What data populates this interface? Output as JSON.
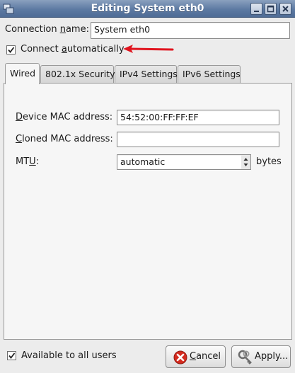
{
  "window": {
    "title": "Editing System eth0"
  },
  "connection": {
    "name_label_pre": "Connection ",
    "name_label_u": "n",
    "name_label_post": "ame:",
    "name_value": "System eth0"
  },
  "connect_automatically": {
    "label_pre": "Connect ",
    "label_u": "a",
    "label_post": "utomatically",
    "checked": true
  },
  "tabs": [
    {
      "label": "Wired",
      "active": true
    },
    {
      "label": "802.1x Security",
      "active": false
    },
    {
      "label": "IPv4 Settings",
      "active": false
    },
    {
      "label": "IPv6 Settings",
      "active": false
    }
  ],
  "wired": {
    "device_mac_label_u": "D",
    "device_mac_label_post": "evice MAC address:",
    "device_mac_value": "54:52:00:FF:FF:EF",
    "cloned_mac_label_u": "C",
    "cloned_mac_label_post": "loned MAC address:",
    "cloned_mac_value": "",
    "mtu_label_pre": "MT",
    "mtu_label_u": "U",
    "mtu_label_post": ":",
    "mtu_value": "automatic",
    "mtu_unit": "bytes"
  },
  "footer": {
    "available_label": "Available to all users",
    "available_checked": true,
    "cancel_u": "C",
    "cancel_post": "ancel",
    "apply_label": "Apply..."
  },
  "colors": {
    "titlebar": "#5d7aa3",
    "annotation_arrow": "#e0141e",
    "cancel_icon": "#d42a1e"
  },
  "icons": {
    "window_menu": "window-menu-icon",
    "minimize": "minimize-icon",
    "maximize": "maximize-icon",
    "close": "close-icon",
    "cancel": "cancel-icon",
    "apply": "keys-icon",
    "annotation": "red-arrow"
  }
}
